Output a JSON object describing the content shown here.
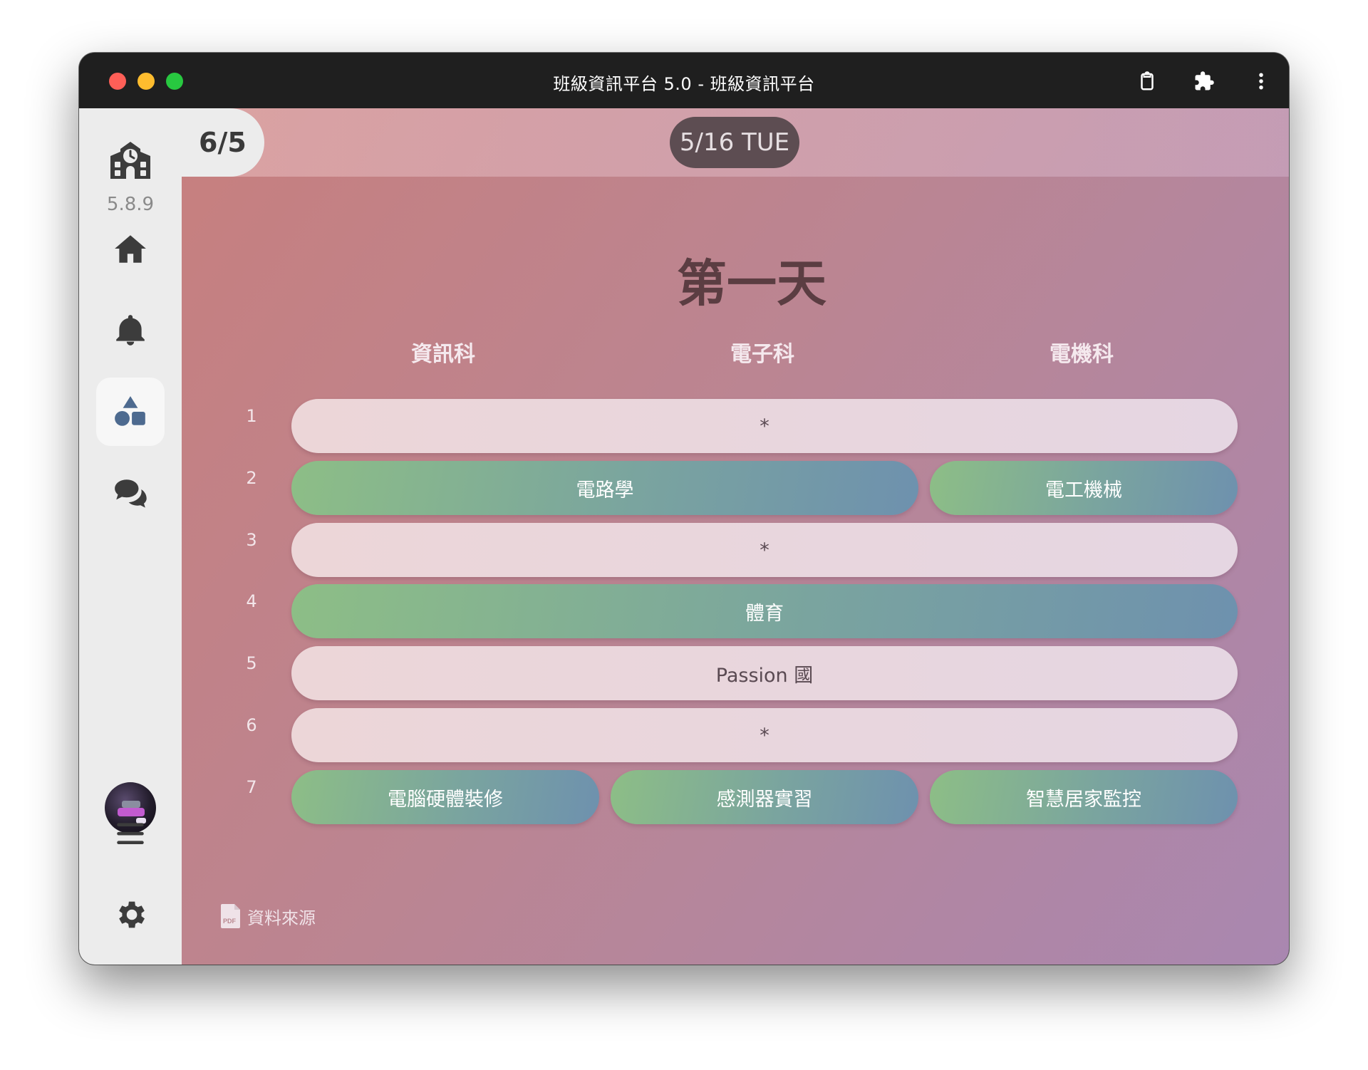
{
  "window": {
    "title": "班級資訊平台 5.0 - 班級資訊平台"
  },
  "sidebar": {
    "version": "5.8.9",
    "items": [
      {
        "name": "home",
        "icon": "home-icon"
      },
      {
        "name": "notifications",
        "icon": "bell-icon"
      },
      {
        "name": "shapes",
        "icon": "shapes-icon",
        "active": true
      },
      {
        "name": "chat",
        "icon": "chat-icon"
      },
      {
        "name": "menu",
        "icon": "hamburger-menu-icon"
      },
      {
        "name": "settings",
        "icon": "gear-icon"
      }
    ]
  },
  "header": {
    "counter": "6/5",
    "date": "5/16 TUE"
  },
  "schedule": {
    "title": "第一天",
    "columns": [
      "資訊科",
      "電子科",
      "電機科"
    ],
    "periods": [
      {
        "num": "1",
        "cells": [
          {
            "text": "*",
            "span": 3,
            "style": "light"
          }
        ]
      },
      {
        "num": "2",
        "cells": [
          {
            "text": "電路學",
            "span": 2,
            "style": "green"
          },
          {
            "text": "電工機械",
            "span": 1,
            "style": "green"
          }
        ]
      },
      {
        "num": "3",
        "cells": [
          {
            "text": "*",
            "span": 3,
            "style": "light"
          }
        ]
      },
      {
        "num": "4",
        "cells": [
          {
            "text": "體育",
            "span": 3,
            "style": "green"
          }
        ]
      },
      {
        "num": "5",
        "cells": [
          {
            "text": "Passion 國",
            "span": 3,
            "style": "light"
          }
        ]
      },
      {
        "num": "6",
        "cells": [
          {
            "text": "*",
            "span": 3,
            "style": "light"
          }
        ]
      },
      {
        "num": "7",
        "cells": [
          {
            "text": "電腦硬體裝修",
            "span": 1,
            "style": "green"
          },
          {
            "text": "感測器實習",
            "span": 1,
            "style": "green"
          },
          {
            "text": "智慧居家監控",
            "span": 1,
            "style": "green"
          }
        ]
      }
    ]
  },
  "footer": {
    "source_label": "資料來源",
    "source_icon": "pdf-file-icon"
  },
  "colors": {
    "accent_blue": "#4d6a8f",
    "cell_green_start": "#8dbe86",
    "cell_green_end": "#6e91ae",
    "date_pill": "#5d4d52"
  }
}
